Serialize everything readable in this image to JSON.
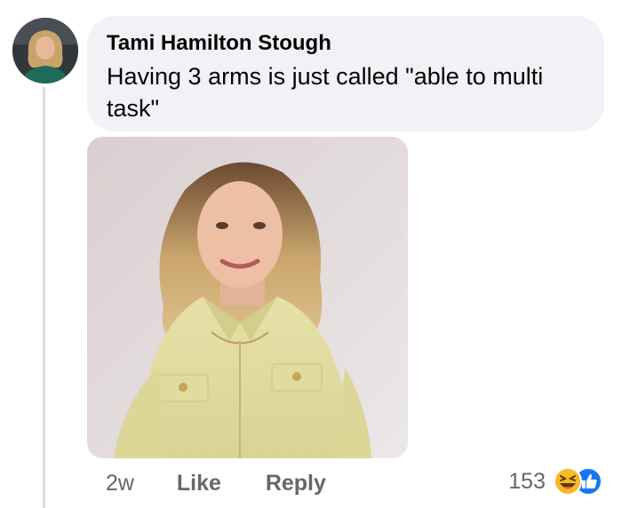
{
  "comment": {
    "author": "Tami Hamilton Stough",
    "text": "Having 3 arms is just called \"able to multi task\"",
    "timestamp": "2w",
    "like_label": "Like",
    "reply_label": "Reply",
    "reaction_count": "153",
    "reactions": [
      "haha-icon",
      "like-icon"
    ]
  },
  "colors": {
    "bubble": "#f0f2f5",
    "text": "#050505",
    "secondary": "#65676b",
    "like_blue": "#1877f2",
    "haha_yellow": "#f7b928"
  }
}
